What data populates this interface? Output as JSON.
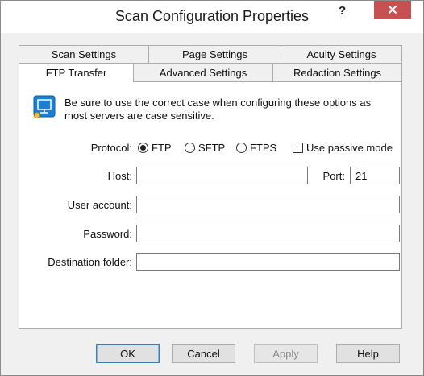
{
  "window": {
    "title": "Scan Configuration Properties",
    "help_glyph": "?"
  },
  "tabs": {
    "row1": [
      {
        "label": "Scan Settings"
      },
      {
        "label": "Page Settings"
      },
      {
        "label": "Acuity Settings"
      }
    ],
    "row2": [
      {
        "label": "FTP Transfer",
        "active": true
      },
      {
        "label": "Advanced Settings"
      },
      {
        "label": "Redaction Settings"
      }
    ]
  },
  "info": {
    "icon": "ftp-config-icon",
    "text": "Be sure to use the correct case when configuring these options as most servers are case sensitive."
  },
  "protocol": {
    "label": "Protocol:",
    "options": [
      "FTP",
      "SFTP",
      "FTPS"
    ],
    "selected": "FTP",
    "passive_label": "Use passive mode",
    "passive_checked": false
  },
  "fields": {
    "host": {
      "label": "Host:",
      "value": ""
    },
    "port": {
      "label": "Port:",
      "value": "21"
    },
    "user": {
      "label": "User account:",
      "value": ""
    },
    "password": {
      "label": "Password:",
      "value": ""
    },
    "destination": {
      "label": "Destination folder:",
      "value": ""
    }
  },
  "buttons": {
    "ok": "OK",
    "cancel": "Cancel",
    "apply": "Apply",
    "help": "Help"
  },
  "colors": {
    "close_button": "#c75050",
    "default_button_border": "#3c7fb1",
    "icon_blue": "#1c7fd6"
  }
}
